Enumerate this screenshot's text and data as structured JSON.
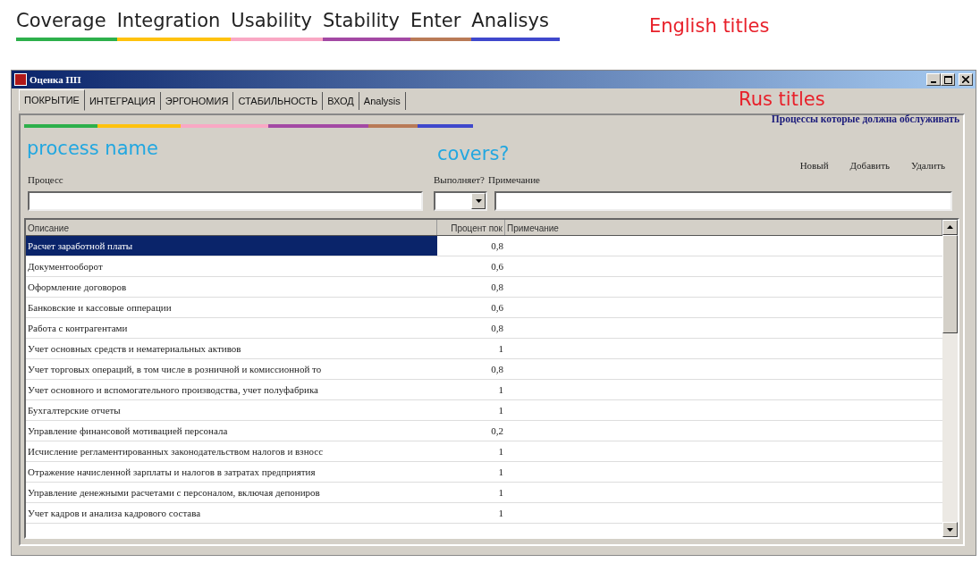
{
  "annotations": {
    "english_titles": [
      {
        "label": "Coverage",
        "color": "#2db04b"
      },
      {
        "label": "Integration",
        "color": "#ffc20e"
      },
      {
        "label": "Usability",
        "color": "#f9a8c4"
      },
      {
        "label": "Stability",
        "color": "#a349a4"
      },
      {
        "label": "Enter",
        "color": "#b97a57"
      },
      {
        "label": "Analisys",
        "color": "#3f48cc"
      }
    ],
    "english_caption": "English titles",
    "rus_caption": "Rus titles",
    "process_caption": "process name",
    "covers_caption": "covers?"
  },
  "window": {
    "title": "Оценка ПП"
  },
  "tabs": [
    {
      "label": "ПОКРЫТИЕ",
      "selected": true
    },
    {
      "label": "ИНТЕГРАЦИЯ",
      "selected": false
    },
    {
      "label": "ЭРГОНОМИЯ",
      "selected": false
    },
    {
      "label": "СТАБИЛЬНОСТЬ",
      "selected": false
    },
    {
      "label": "ВХОД",
      "selected": false
    },
    {
      "label": "Analysis",
      "selected": false
    }
  ],
  "color_bar": [
    {
      "color": "#2db04b"
    },
    {
      "color": "#ffc20e"
    },
    {
      "color": "#f9a8c4"
    },
    {
      "color": "#a349a4"
    },
    {
      "color": "#b97a57"
    },
    {
      "color": "#3f48cc"
    }
  ],
  "section_title": "Процессы которые должна обслуживать",
  "form": {
    "process_label": "Процесс",
    "covers_label": "Выполняет?",
    "note_label": "Примечание"
  },
  "buttons": [
    "Новый",
    "Добавить",
    "Удалить"
  ],
  "table": {
    "columns": [
      "Описание",
      "Процент пок",
      "Примечание"
    ],
    "rows": [
      {
        "description": "Расчет заработной платы",
        "percent": "0,8",
        "selected": true
      },
      {
        "description": "Документооборот",
        "percent": "0,6",
        "selected": false
      },
      {
        "description": "Оформление договоров",
        "percent": "0,8",
        "selected": false
      },
      {
        "description": "Банковские и кассовые опперации",
        "percent": "0,6",
        "selected": false
      },
      {
        "description": "Работа с контрагентами",
        "percent": "0,8",
        "selected": false
      },
      {
        "description": "Учет основных средств и нематериальных активов",
        "percent": "1",
        "selected": false
      },
      {
        "description": "Учет торговых операций, в том числе в розничной и комиссионной то",
        "percent": "0,8",
        "selected": false
      },
      {
        "description": "Учет основного и вспомогательного производства, учет полуфабрика",
        "percent": "1",
        "selected": false
      },
      {
        "description": "Бухгалтерские отчеты",
        "percent": "1",
        "selected": false
      },
      {
        "description": "Управление финансовой мотивацией персонала",
        "percent": "0,2",
        "selected": false
      },
      {
        "description": "Исчисление регламентированных законодательством налогов и взносс",
        "percent": "1",
        "selected": false
      },
      {
        "description": "Отражение начисленной зарплаты и налогов в затратах предприятия",
        "percent": "1",
        "selected": false
      },
      {
        "description": "Управление денежными расчетами с персоналом, включая депониров",
        "percent": "1",
        "selected": false
      },
      {
        "description": "Учет кадров и анализа кадрового состава",
        "percent": "1",
        "selected": false
      }
    ]
  }
}
